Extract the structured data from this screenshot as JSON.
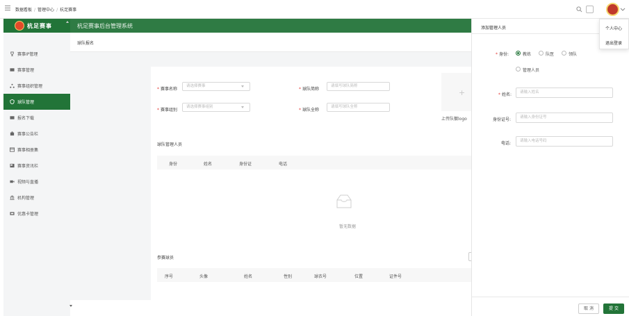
{
  "breadcrumb": [
    "数据看板",
    "管理中心",
    "杭足赛事"
  ],
  "sidebar": {
    "logo_text": "杭足赛事",
    "items": [
      {
        "label": "赛事IP管理",
        "icon": "trophy-icon"
      },
      {
        "label": "赛事管理",
        "icon": "grid-icon"
      },
      {
        "label": "赛事组织管理",
        "icon": "org-icon"
      },
      {
        "label": "球队管理",
        "icon": "shield-icon",
        "active": true
      },
      {
        "label": "报名下载",
        "icon": "download-icon"
      },
      {
        "label": "赛事公告栏",
        "icon": "notice-icon"
      },
      {
        "label": "赛事相册集",
        "icon": "album-icon"
      },
      {
        "label": "赛事资讯栏",
        "icon": "news-icon"
      },
      {
        "label": "视频与直播",
        "icon": "video-icon"
      },
      {
        "label": "机构管理",
        "icon": "building-icon"
      },
      {
        "label": "优惠卡管理",
        "icon": "card-icon"
      }
    ]
  },
  "main": {
    "system_title": "杭足赛事后台管理系统",
    "page_title": "球队报名",
    "form": {
      "event_name_label": "赛事名称",
      "event_name_placeholder": "请选择赛事",
      "team_short_label": "球队简称",
      "team_short_placeholder": "请填写球队简称",
      "event_group_label": "赛事组别",
      "event_group_placeholder": "请选择赛事组别",
      "team_full_label": "球队全称",
      "team_full_placeholder": "请填写球队全称",
      "upload_plus": "+",
      "upload_label": "上传队徽logo"
    },
    "managers": {
      "title": "球队管理人员",
      "columns": [
        "身份",
        "姓名",
        "身份证",
        "电话"
      ],
      "empty_text": "暂无数据"
    },
    "players": {
      "title": "参赛球员",
      "columns": [
        "序号",
        "头像",
        "姓名",
        "性别",
        "球衣号",
        "位置",
        "证件号"
      ]
    }
  },
  "drawer": {
    "title": "添加管理人员",
    "identity_label": "身份:",
    "identity_options": [
      "教练",
      "队医",
      "领队",
      "管理人员"
    ],
    "identity_selected": "教练",
    "name_label": "姓名:",
    "name_placeholder": "请输入姓名",
    "id_label": "身份证号:",
    "id_placeholder": "请输入身份证号",
    "phone_label": "电话:",
    "phone_placeholder": "请输入电话号码",
    "cancel": "取 消",
    "submit": "提 交"
  },
  "user_menu": {
    "items": [
      "个人中心",
      "退出登录"
    ]
  },
  "colors": {
    "brand_green": "#227438",
    "header_green": "#2f7b44",
    "required_red": "#e53935"
  }
}
